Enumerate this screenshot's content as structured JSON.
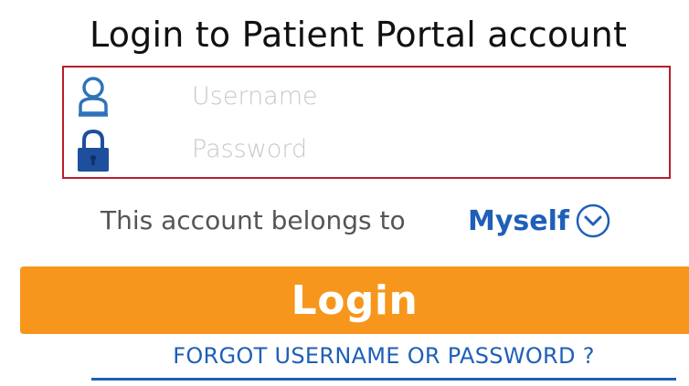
{
  "page": {
    "title": "Login to Patient Portal account"
  },
  "login_form": {
    "username": {
      "placeholder": "Username",
      "value": "",
      "icon": "user-icon"
    },
    "password": {
      "placeholder": "Password",
      "value": "",
      "icon": "lock-icon"
    },
    "border_color": "#b81e2a"
  },
  "account_owner": {
    "label": "This account belongs to",
    "selected": "Myself",
    "icon": "chevron-down-circle-icon"
  },
  "login_button": {
    "label": "Login",
    "color": "#f7961c"
  },
  "forgot_link": {
    "label": "FORGOT USERNAME OR PASSWORD ?"
  },
  "colors": {
    "accent_blue": "#1f5fb8",
    "text_gray": "#555555",
    "placeholder_gray": "#c8c8c8"
  }
}
